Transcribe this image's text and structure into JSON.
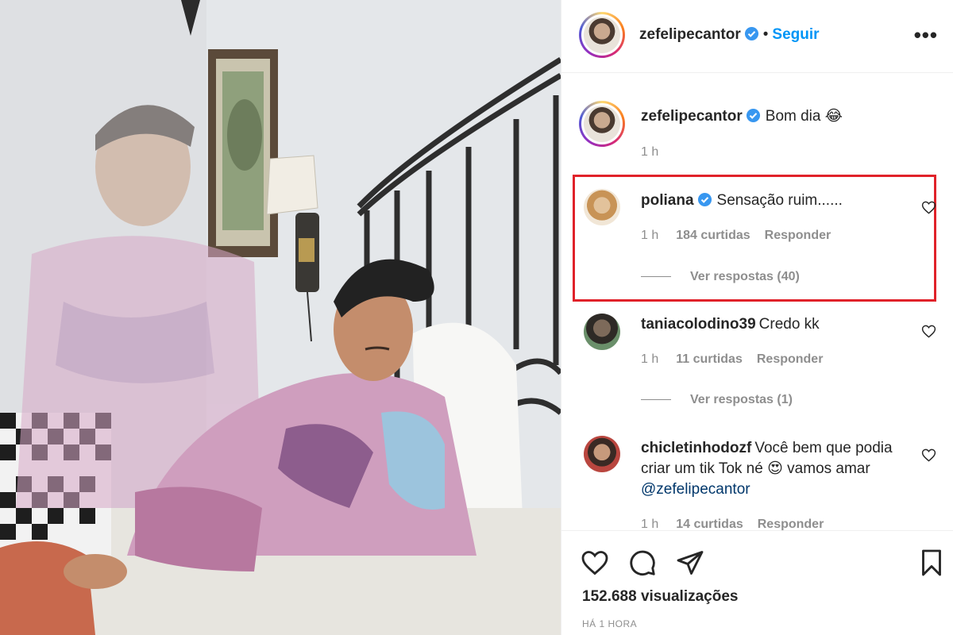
{
  "post": {
    "author": "zefelipecantor",
    "follow_label": "Seguir",
    "dot": "•",
    "more": "•••"
  },
  "caption": {
    "username": "zefelipecantor",
    "text": "Bom dia 😂",
    "time": "1 h"
  },
  "comments": [
    {
      "username": "poliana",
      "verified": true,
      "text": "Sensação ruim......",
      "time": "1 h",
      "likes": "184 curtidas",
      "reply_label": "Responder",
      "view_replies": "Ver respostas (40)"
    },
    {
      "username": "taniacolodino39",
      "verified": false,
      "text": "Credo kk",
      "time": "1 h",
      "likes": "11 curtidas",
      "reply_label": "Responder",
      "view_replies": "Ver respostas (1)"
    },
    {
      "username": "chicletinhodozf",
      "verified": false,
      "text": "Você bem que podia criar um tik Tok né 😍 vamos amar",
      "mention": "@zefelipecantor",
      "time": "1 h",
      "likes": "14 curtidas",
      "reply_label": "Responder"
    }
  ],
  "footer": {
    "views": "152.688 visualizações",
    "posted": "HÁ 1 HORA"
  },
  "icons": [
    "heart-icon",
    "comment-icon",
    "share-icon",
    "bookmark-icon",
    "verified-badge-icon",
    "more-options-icon"
  ],
  "colors": {
    "link_blue": "#0095f6",
    "verified_blue": "#3897f0",
    "highlight_red": "#e0222a",
    "muted_text": "#8e8e8e"
  }
}
